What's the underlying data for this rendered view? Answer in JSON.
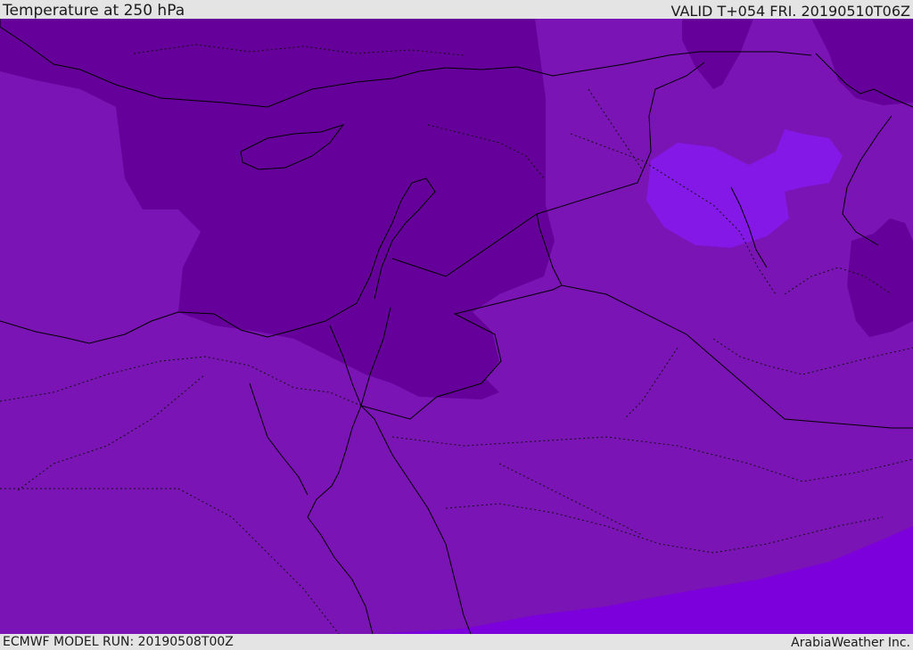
{
  "header": {
    "title": "Temperature at 250 hPa",
    "valid_label": "VALID T+054 FRI. 20190510T06Z"
  },
  "footer": {
    "model_run": "ECMWF MODEL RUN: 20190508T00Z",
    "credit": "ArabiaWeather Inc."
  },
  "colors": {
    "background_field": "#7a14b4",
    "cold_core": "#66009a",
    "warm_band": "#7c00dc",
    "warm_patch": "#8418e6",
    "border_line": "#000000"
  }
}
